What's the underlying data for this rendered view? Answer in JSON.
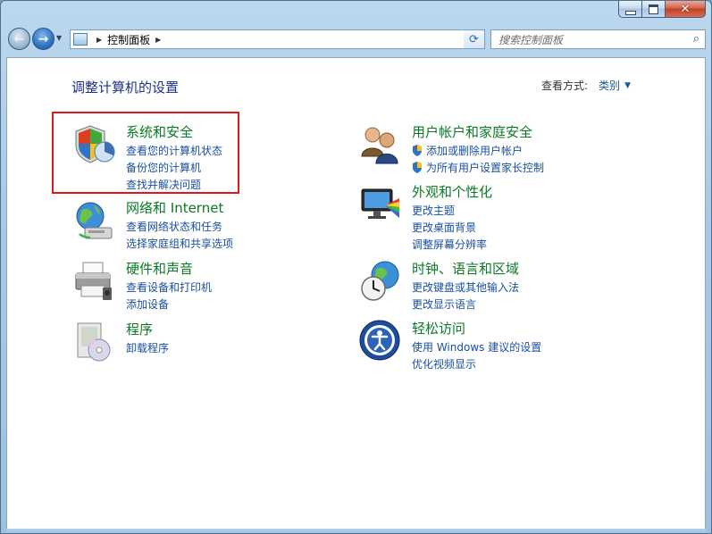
{
  "window": {
    "caption_buttons": [
      "minimize",
      "maximize",
      "close"
    ]
  },
  "nav": {
    "breadcrumb": "控制面板",
    "search_placeholder": "搜索控制面板"
  },
  "page": {
    "title": "调整计算机的设置",
    "view_by_label": "查看方式:",
    "view_by_value": "类别"
  },
  "categories": [
    {
      "icon": "security-shield-icon",
      "title": "系统和安全",
      "links": [
        "查看您的计算机状态",
        "备份您的计算机",
        "查找并解决问题"
      ]
    },
    {
      "icon": "network-globe-icon",
      "title": "网络和 Internet",
      "links": [
        "查看网络状态和任务",
        "选择家庭组和共享选项"
      ]
    },
    {
      "icon": "printer-icon",
      "title": "硬件和声音",
      "links": [
        "查看设备和打印机",
        "添加设备"
      ]
    },
    {
      "icon": "programs-icon",
      "title": "程序",
      "links": [
        "卸载程序"
      ]
    },
    {
      "icon": "users-icon",
      "title": "用户帐户和家庭安全",
      "links": [
        "添加或删除用户帐户",
        "为所有用户设置家长控制"
      ]
    },
    {
      "icon": "appearance-monitor-icon",
      "title": "外观和个性化",
      "links": [
        "更改主题",
        "更改桌面背景",
        "调整屏幕分辨率"
      ]
    },
    {
      "icon": "clock-globe-icon",
      "title": "时钟、语言和区域",
      "links": [
        "更改键盘或其他输入法",
        "更改显示语言"
      ]
    },
    {
      "icon": "ease-of-access-icon",
      "title": "轻松访问",
      "links": [
        "使用 Windows 建议的设置",
        "优化视频显示"
      ]
    }
  ],
  "colors": {
    "category_title": "#0a7a26",
    "link": "#1a4fa0",
    "page_title": "#1e3287",
    "highlight_box": "#e0181c"
  }
}
